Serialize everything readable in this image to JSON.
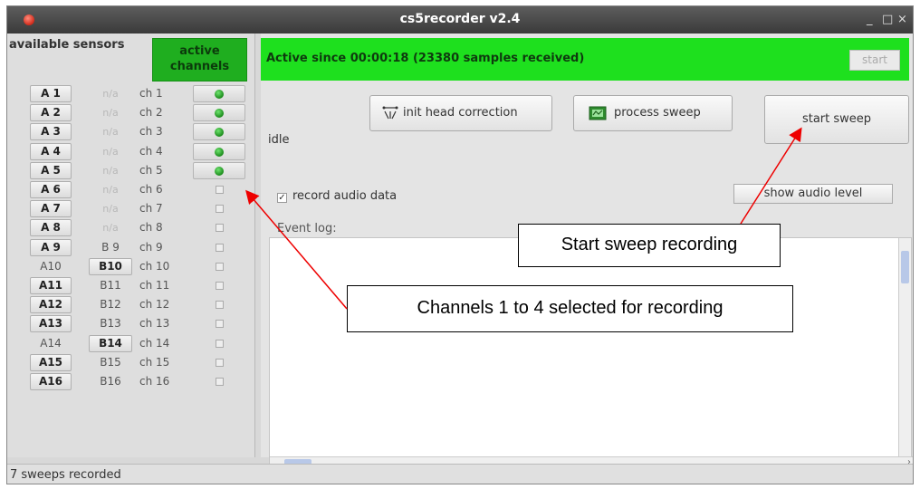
{
  "window": {
    "title": "cs5recorder v2.4",
    "controls": [
      "_",
      "□",
      "×"
    ]
  },
  "left": {
    "available_header": "available sensors",
    "active_header": "active channels",
    "rows": [
      {
        "a": "A 1",
        "a_btn": true,
        "b": "n/a",
        "b_btn": false,
        "b_na": true,
        "ch": "ch  1",
        "active": true
      },
      {
        "a": "A 2",
        "a_btn": true,
        "b": "n/a",
        "b_btn": false,
        "b_na": true,
        "ch": "ch  2",
        "active": true
      },
      {
        "a": "A 3",
        "a_btn": true,
        "b": "n/a",
        "b_btn": false,
        "b_na": true,
        "ch": "ch  3",
        "active": true
      },
      {
        "a": "A 4",
        "a_btn": true,
        "b": "n/a",
        "b_btn": false,
        "b_na": true,
        "ch": "ch  4",
        "active": true
      },
      {
        "a": "A 5",
        "a_btn": true,
        "b": "n/a",
        "b_btn": false,
        "b_na": true,
        "ch": "ch  5",
        "active": true
      },
      {
        "a": "A 6",
        "a_btn": true,
        "b": "n/a",
        "b_btn": false,
        "b_na": true,
        "ch": "ch  6",
        "active": false
      },
      {
        "a": "A 7",
        "a_btn": true,
        "b": "n/a",
        "b_btn": false,
        "b_na": true,
        "ch": "ch  7",
        "active": false
      },
      {
        "a": "A 8",
        "a_btn": true,
        "b": "n/a",
        "b_btn": false,
        "b_na": true,
        "ch": "ch  8",
        "active": false
      },
      {
        "a": "A 9",
        "a_btn": true,
        "b": "B 9",
        "b_btn": false,
        "b_na": false,
        "ch": "ch  9",
        "active": false
      },
      {
        "a": "A10",
        "a_btn": false,
        "b": "B10",
        "b_btn": true,
        "b_na": false,
        "ch": "ch 10",
        "active": false
      },
      {
        "a": "A11",
        "a_btn": true,
        "b": "B11",
        "b_btn": false,
        "b_na": false,
        "ch": "ch 11",
        "active": false
      },
      {
        "a": "A12",
        "a_btn": true,
        "b": "B12",
        "b_btn": false,
        "b_na": false,
        "ch": "ch 12",
        "active": false
      },
      {
        "a": "A13",
        "a_btn": true,
        "b": "B13",
        "b_btn": false,
        "b_na": false,
        "ch": "ch 13",
        "active": false
      },
      {
        "a": "A14",
        "a_btn": false,
        "b": "B14",
        "b_btn": true,
        "b_na": false,
        "ch": "ch 14",
        "active": false
      },
      {
        "a": "A15",
        "a_btn": true,
        "b": "B15",
        "b_btn": false,
        "b_na": false,
        "ch": "ch 15",
        "active": false
      },
      {
        "a": "A16",
        "a_btn": true,
        "b": "B16",
        "b_btn": false,
        "b_na": false,
        "ch": "ch 16",
        "active": false
      }
    ]
  },
  "status": {
    "active_text": "Active since 00:00:18 (23380 samples received)",
    "start_label": "start",
    "state": "idle",
    "accent_color": "#1ee01e"
  },
  "actions": {
    "init_head_label": "init head correction",
    "process_sweep_label": "process sweep",
    "start_sweep_label": "start sweep",
    "record_audio_label": "record audio data",
    "record_audio_checked": true,
    "show_audio_label": "show audio level"
  },
  "log": {
    "label": "Event log:"
  },
  "footer": {
    "status": "7 sweeps recorded"
  },
  "annotations": {
    "start_sweep": "Start sweep recording",
    "channels": "Channels 1 to 4 selected for recording"
  }
}
